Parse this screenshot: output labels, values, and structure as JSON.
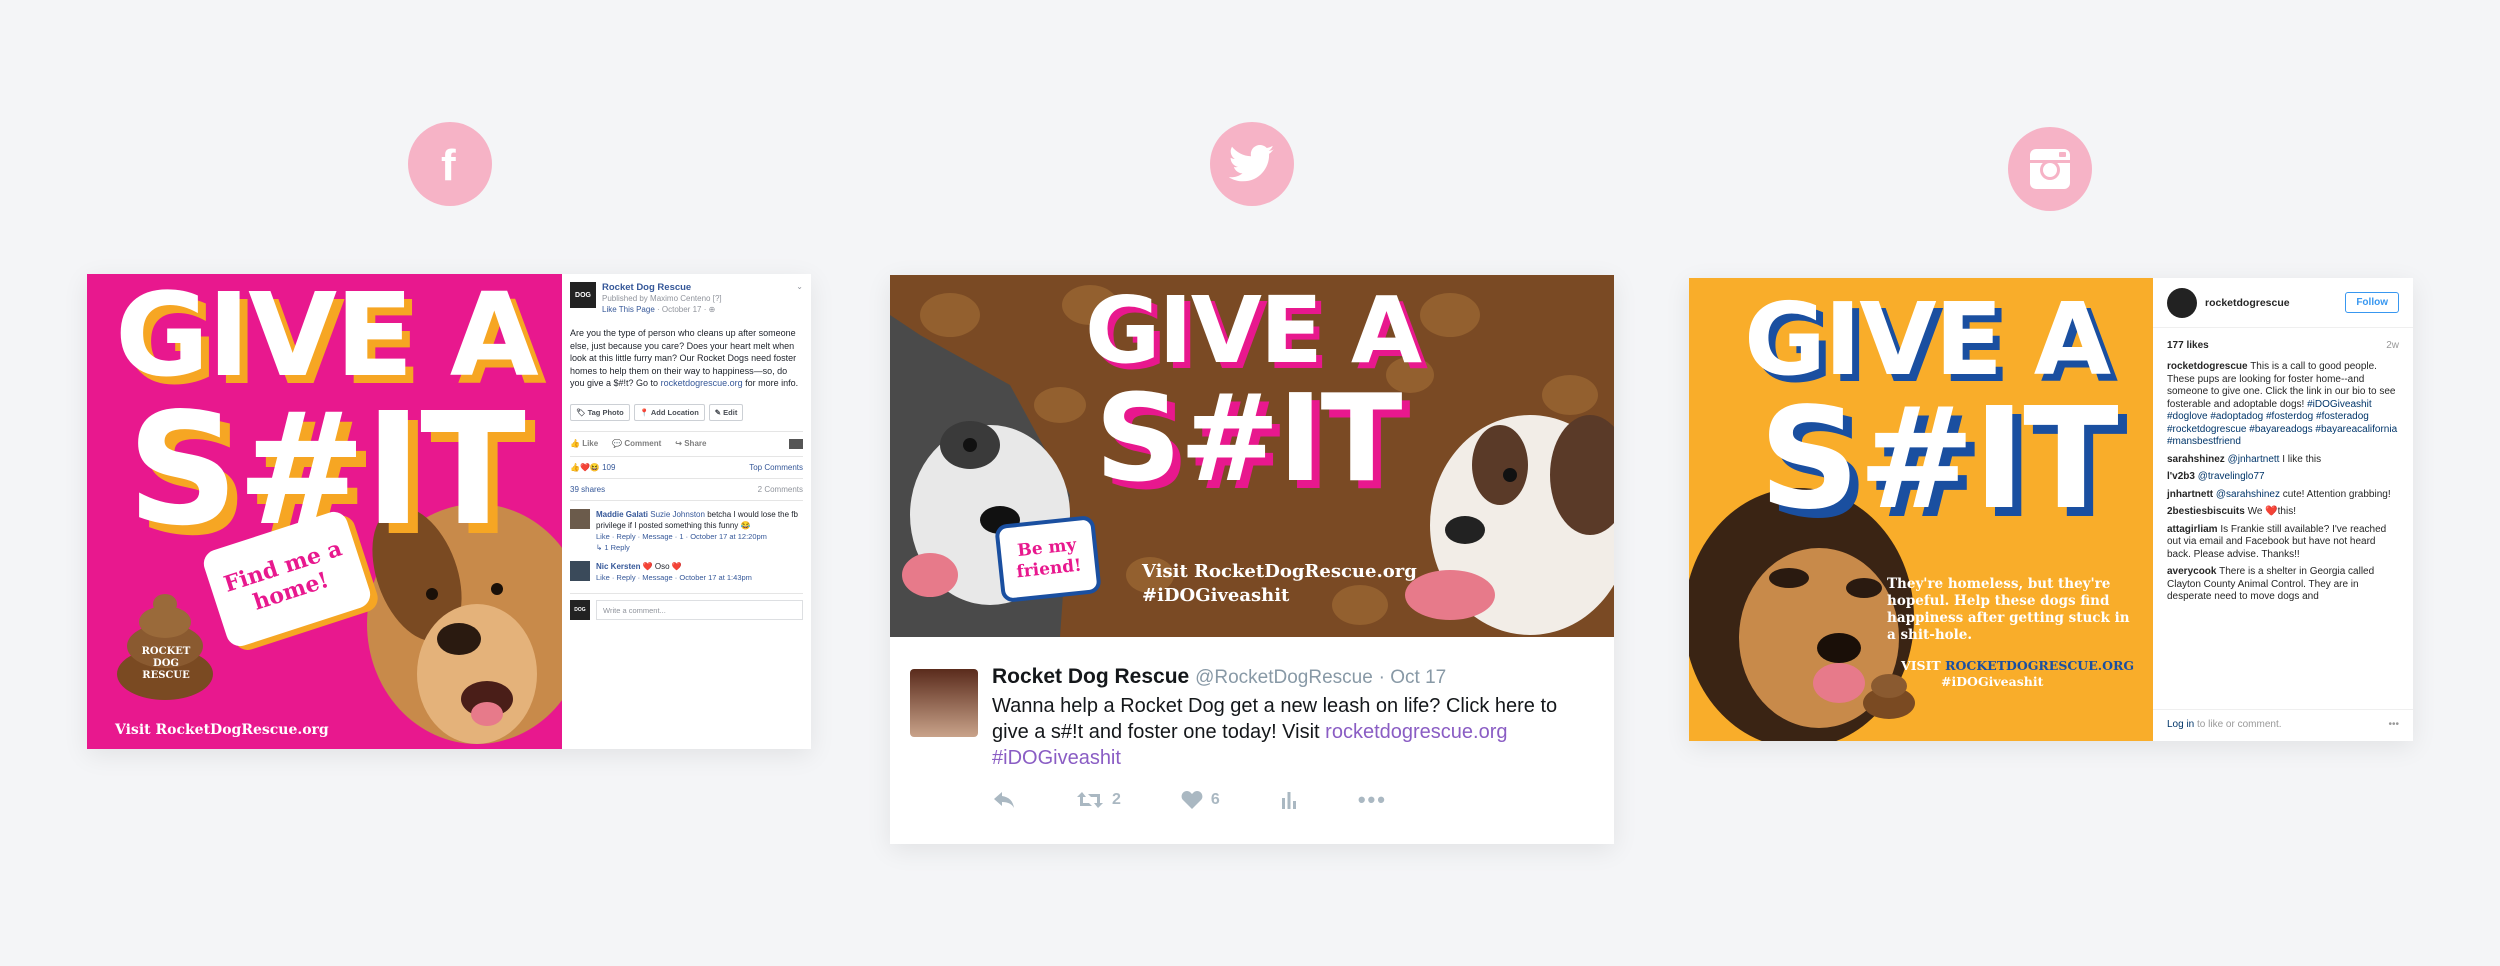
{
  "icons": {
    "facebook": "facebook-icon",
    "twitter": "twitter-icon",
    "instagram": "instagram-icon",
    "color": "#f6b3c6"
  },
  "poster": {
    "headline_1": "GIVE A",
    "headline_2": "S#IT"
  },
  "facebook": {
    "bubble_text": "Find me a home!",
    "bottom_text": "Visit RocketDogRescue.org",
    "logo_text": "ROCKET DOG RESCUE",
    "page_name": "Rocket Dog Rescue",
    "published_by": "Published by Maximo Centeno [?]",
    "like_page": "Like This Page",
    "date": "October 17",
    "post_text": "Are you the type of person who cleans up after someone else, just because you care? Does your heart melt when look at this little furry man? Our Rocket Dogs need foster homes to help them on their way to happiness—so, do you give a $#!t? Go to",
    "post_link": "rocketdogrescue.org",
    "post_text_end": "for more info.",
    "tag_photo": "Tag Photo",
    "add_location": "Add Location",
    "edit": "Edit",
    "like": "Like",
    "comment": "Comment",
    "share": "Share",
    "reaction_count": "109",
    "top_comments": "Top Comments",
    "shares": "39 shares",
    "comments_count": "2 Comments",
    "comments": [
      {
        "name": "Maddie Galati",
        "mention": "Suzie Johnston",
        "text": "betcha I would lose the fb privilege if I posted something this funny 😂",
        "meta": "Like · Reply · Message · 1 · October 17 at 12:20pm",
        "reply": "1 Reply"
      },
      {
        "name": "Nic Kersten",
        "text": "❤️ Oso ❤️",
        "meta": "Like · Reply · Message · October 17 at 1:43pm"
      }
    ],
    "write_placeholder": "Write a comment..."
  },
  "twitter": {
    "bubble_text": "Be my friend!",
    "visit_line1": "Visit RocketDogRescue.org",
    "visit_line2": "#iDOGiveashit",
    "name": "Rocket Dog Rescue",
    "handle": "@RocketDogRescue",
    "date": "· Oct 17",
    "text": "Wanna help a Rocket Dog get a new leash on life? Click here to give a s#!t and foster one today! Visit",
    "link": "rocketdogrescue.org",
    "hashtag": "#iDOGiveashit",
    "retweets": "2",
    "likes": "6"
  },
  "instagram": {
    "poster_text": "They're homeless, but they're hopeful. Help these dogs find happiness after getting stuck in a shit-hole.",
    "visit_prefix": "VISIT",
    "visit_link": "ROCKETDOGRESCUE.ORG",
    "visit_tag": "#iDOGiveashit",
    "username": "rocketdogrescue",
    "follow": "Follow",
    "likes": "177 likes",
    "age": "2w",
    "caption_user": "rocketdogrescue",
    "caption": "This is a call to good people. These pups are looking for foster home--and someone to give one. Click the link in our bio to see fosterable and adoptable dogs!",
    "caption_tags": "#iDOGiveashit #doglove #adoptadog #fosterdog #fosteradog #rocketdogrescue #bayareadogs #bayareacalifornia #mansbestfriend",
    "comments": [
      {
        "user": "sarahshinez",
        "mention": "@jnhartnett",
        "text": "I like this"
      },
      {
        "user": "l'v2b3",
        "mention": "@travelinglo77",
        "text": ""
      },
      {
        "user": "jnhartnett",
        "mention": "@sarahshinez",
        "text": "cute! Attention grabbing!"
      },
      {
        "user": "2bestiesbiscuits",
        "mention": "",
        "text": "We ❤️this!"
      },
      {
        "user": "attagirliam",
        "mention": "",
        "text": "Is Frankie still available? I've reached out via email and Facebook but have not heard back. Please advise. Thanks!!"
      },
      {
        "user": "averycook",
        "mention": "",
        "text": "There is a shelter in Georgia called Clayton County Animal Control. They are in desperate need to move dogs and"
      }
    ],
    "login": "Log in",
    "login_rest": "to like or comment.",
    "more": "•••"
  }
}
